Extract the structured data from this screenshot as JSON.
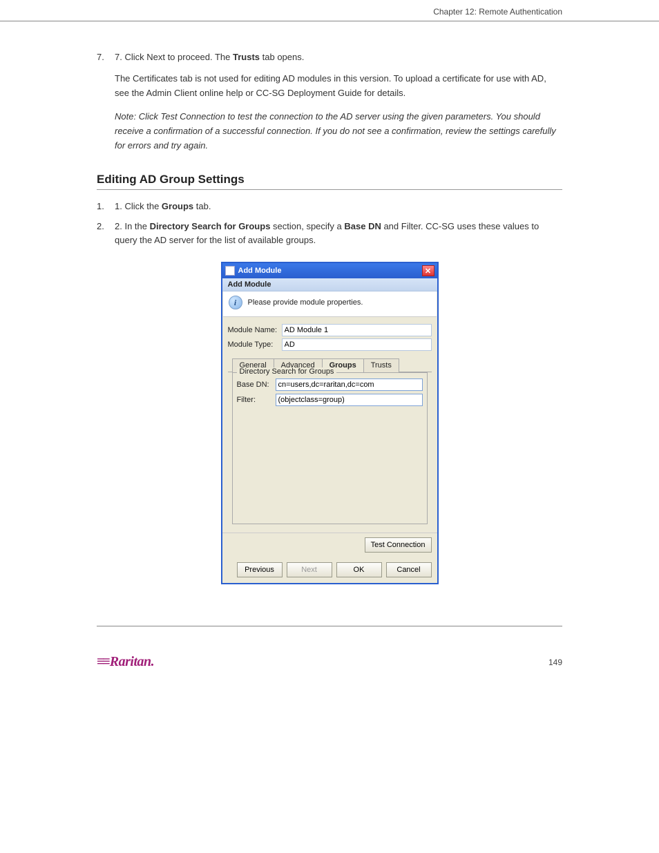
{
  "header": {
    "chapter_label": "Chapter 12: Remote Authentication"
  },
  "paragraphs": {
    "p1a": "7. Click Next to proceed. The ",
    "p1b": "Trusts",
    "p1c": " tab opens.",
    "p2": "The Certificates tab is not used for editing AD modules in this version. To upload a certificate for use with AD, see the Admin Client online help or CC-SG Deployment Guide for details.",
    "note_label": "Note: ",
    "note_body": "Click Test Connection to test the connection to the AD server using the given parameters. You should receive a confirmation of a successful connection. If you do not see a confirmation, review the settings carefully for errors and try again.",
    "step1a": "1. Click the ",
    "step1b": "Groups",
    "step1c": " tab.",
    "step2a": "2. In the ",
    "step2b": "Directory Search for Groups",
    "step2c": " section, specify a ",
    "step2d": "Base DN",
    "step2e": " and Filter. CC-SG uses these values to query the AD server for the list of available groups."
  },
  "section": {
    "title": "Editing AD Group Settings"
  },
  "dialog": {
    "window_title": "Add Module",
    "subtitle": "Add Module",
    "info_text": "Please provide module properties.",
    "module_name_label": "Module Name:",
    "module_name_value": "AD Module 1",
    "module_type_label": "Module Type:",
    "module_type_value": "AD",
    "tabs": {
      "general": "General",
      "advanced": "Advanced",
      "groups": "Groups",
      "trusts": "Trusts"
    },
    "groupbox_title": "Directory Search for Groups",
    "base_dn_label": "Base DN:",
    "base_dn_value": "cn=users,dc=raritan,dc=com",
    "filter_label": "Filter:",
    "filter_value": "(objectclass=group)",
    "buttons": {
      "test_connection": "Test Connection",
      "previous": "Previous",
      "next": "Next",
      "ok": "OK",
      "cancel": "Cancel"
    }
  },
  "footer": {
    "logo_text": "Raritan.",
    "page_number": "149"
  }
}
